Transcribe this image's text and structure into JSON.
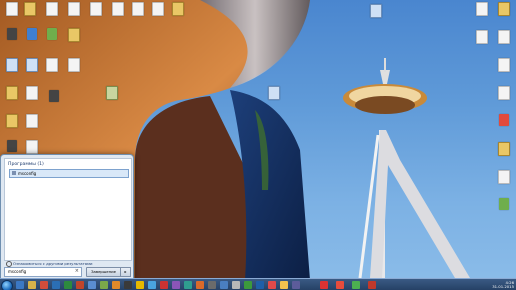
{
  "desktop_icons_left": [
    {
      "name": "desktop-icon-1",
      "label": "",
      "glyph": "g-doc"
    },
    {
      "name": "desktop-icon-2",
      "label": "",
      "glyph": "g-folder"
    },
    {
      "name": "desktop-icon-3",
      "label": "",
      "glyph": "g-doc"
    },
    {
      "name": "desktop-icon-4",
      "label": "",
      "glyph": "g-doc"
    },
    {
      "name": "desktop-icon-5",
      "label": "",
      "glyph": "g-doc"
    },
    {
      "name": "desktop-icon-6",
      "label": "",
      "glyph": "g-doc"
    },
    {
      "name": "desktop-icon-7",
      "label": "",
      "glyph": "g-folder"
    }
  ],
  "start_menu": {
    "header": "Программы (1)",
    "result": "msconfig",
    "more_results": "Ознакомиться с другими результатами",
    "search_value": "msconfig",
    "clear_glyph": "×",
    "shutdown_label": "Завершение работы",
    "arrow_glyph": "▸"
  },
  "taskbar": {
    "time": "4:26",
    "date": "31.01.2015"
  },
  "colors": {
    "sky": "#5f9ad8",
    "taskbar": "#243f63",
    "accent": "#1f6fc0"
  }
}
